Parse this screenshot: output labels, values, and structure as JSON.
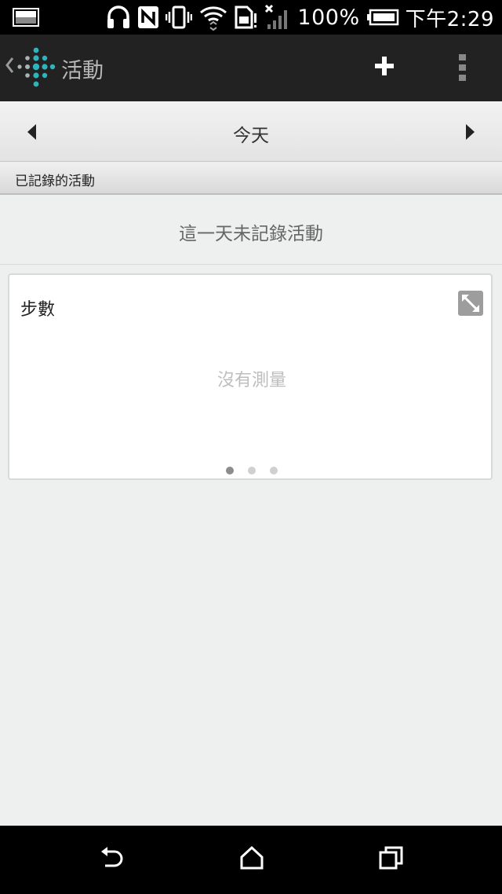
{
  "status_bar": {
    "battery_percent": "100%",
    "time": "下午2:29",
    "icons": [
      "picture-icon",
      "headset-icon",
      "nfc-icon",
      "vibrate-icon",
      "wifi-icon",
      "sim-alert-icon",
      "signal-icon",
      "battery-icon"
    ]
  },
  "action_bar": {
    "title": "活動",
    "icons": [
      "back-caret-icon",
      "fitbit-logo-icon",
      "add-icon",
      "overflow-menu-icon"
    ]
  },
  "date_nav": {
    "label": "今天",
    "icons": [
      "prev-day-icon",
      "next-day-icon"
    ]
  },
  "logged_activities": {
    "header": "已記錄的活動",
    "empty_message": "這一天未記錄活動"
  },
  "steps_card": {
    "title": "步數",
    "empty_message": "沒有測量",
    "pages": 3,
    "active_page": 1,
    "icons": [
      "expand-icon"
    ]
  },
  "nav_bar": {
    "icons": [
      "back-icon",
      "home-icon",
      "recent-apps-icon"
    ]
  },
  "colors": {
    "status_bar": "#000000",
    "action_bar": "#222222",
    "background": "#eeefef",
    "fitbit_teal": "#2fb4bd"
  }
}
